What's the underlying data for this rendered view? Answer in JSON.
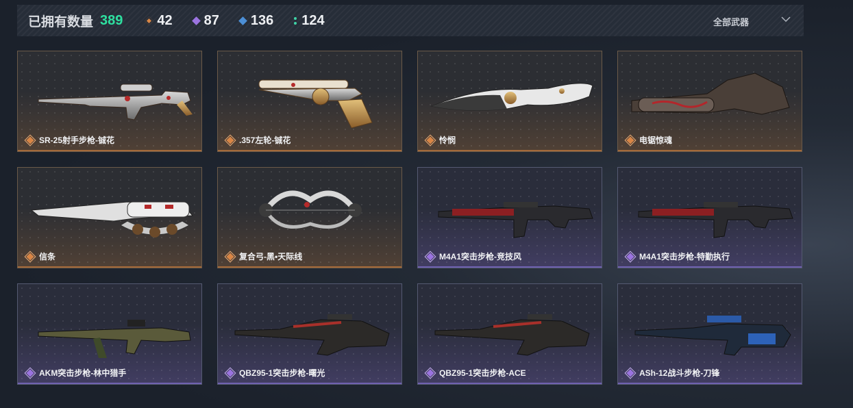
{
  "header": {
    "owned_label": "已拥有数量",
    "owned_count": "389",
    "stats": [
      {
        "icon": "orange-diamond-icon",
        "value": "42"
      },
      {
        "icon": "purple-diamond-icon",
        "value": "87"
      },
      {
        "icon": "blue-diamond-icon",
        "value": "136"
      },
      {
        "icon": "green-dots-icon",
        "value": "124"
      }
    ],
    "filter_label": "全部武器"
  },
  "colors": {
    "owned_count": "#2ee0a0",
    "orange_rarity": "#d98646",
    "purple_rarity": "#9b74e0",
    "blue_rarity": "#4c8fd6",
    "green": "#3fd3a6"
  },
  "weapons": [
    {
      "name": "SR-25射手步枪-铖花",
      "rarity": "orange",
      "icon": "sniper-rifle-icon"
    },
    {
      "name": ".357左轮-铖花",
      "rarity": "orange",
      "icon": "revolver-icon"
    },
    {
      "name": "怜悯",
      "rarity": "orange",
      "icon": "knife-icon"
    },
    {
      "name": "电锯惊魂",
      "rarity": "orange",
      "icon": "chainsaw-icon"
    },
    {
      "name": "信条",
      "rarity": "orange",
      "icon": "knuckle-knife-icon"
    },
    {
      "name": "复合弓-黑•天际线",
      "rarity": "orange",
      "icon": "compound-bow-icon"
    },
    {
      "name": "M4A1突击步枪-竞技风",
      "rarity": "purple",
      "icon": "assault-rifle-icon"
    },
    {
      "name": "M4A1突击步枪-特勤执行",
      "rarity": "purple",
      "icon": "assault-rifle-icon"
    },
    {
      "name": "AKM突击步枪-林中猎手",
      "rarity": "purple",
      "icon": "ak-rifle-icon"
    },
    {
      "name": "QBZ95-1突击步枪-曙光",
      "rarity": "purple",
      "icon": "bullpup-rifle-icon"
    },
    {
      "name": "QBZ95-1突击步枪-ACE",
      "rarity": "purple",
      "icon": "bullpup-rifle-icon"
    },
    {
      "name": "ASh-12战斗步枪-刀锋",
      "rarity": "purple",
      "icon": "battle-rifle-icon"
    }
  ]
}
